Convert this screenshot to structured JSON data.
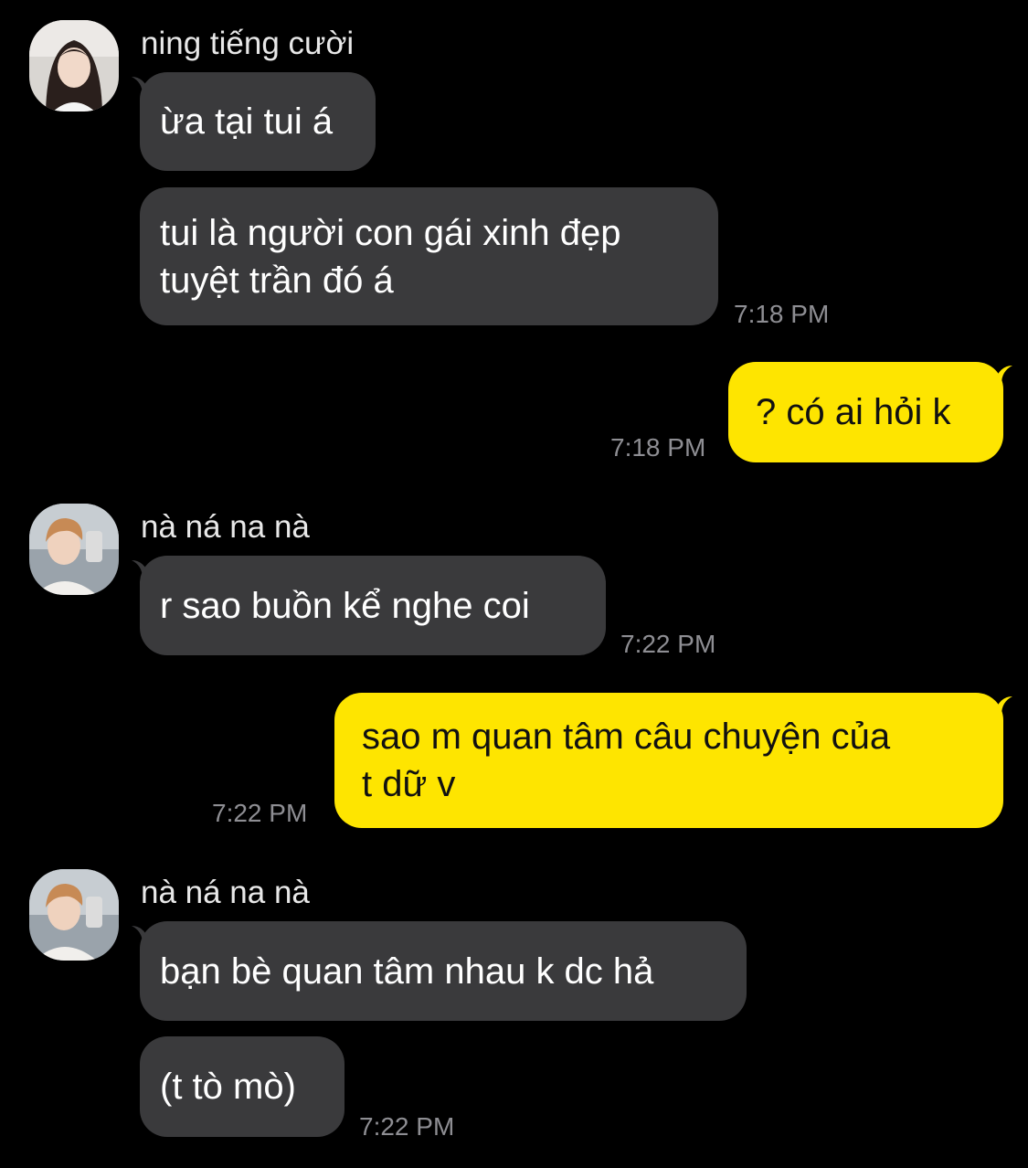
{
  "colors": {
    "background": "#000000",
    "incoming_bubble": "#3a3a3c",
    "outgoing_bubble": "#fee500",
    "timestamp": "#8e8e93"
  },
  "thread": {
    "group1": {
      "sender": "ning tiếng cười",
      "avatar_icon": "user-avatar-photo",
      "messages": [
        "ừa tại tui á",
        "tui là người con gái xinh đẹp",
        "tuyệt trần đó á"
      ],
      "time": "7:18 PM"
    },
    "out1": {
      "text": "? có ai hỏi k",
      "time": "7:18 PM"
    },
    "group2": {
      "sender": "nà ná na nà",
      "avatar_icon": "user-avatar-photo",
      "messages": [
        "r sao buồn kể nghe coi"
      ],
      "time": "7:22 PM"
    },
    "out2": {
      "lines": [
        "sao m quan tâm câu chuyện của",
        "t dữ v"
      ],
      "time": "7:22 PM"
    },
    "group3": {
      "sender": "nà ná na nà",
      "avatar_icon": "user-avatar-photo",
      "messages": [
        "bạn bè quan tâm nhau k dc hả",
        "(t tò mò)"
      ],
      "time": "7:22 PM"
    }
  }
}
